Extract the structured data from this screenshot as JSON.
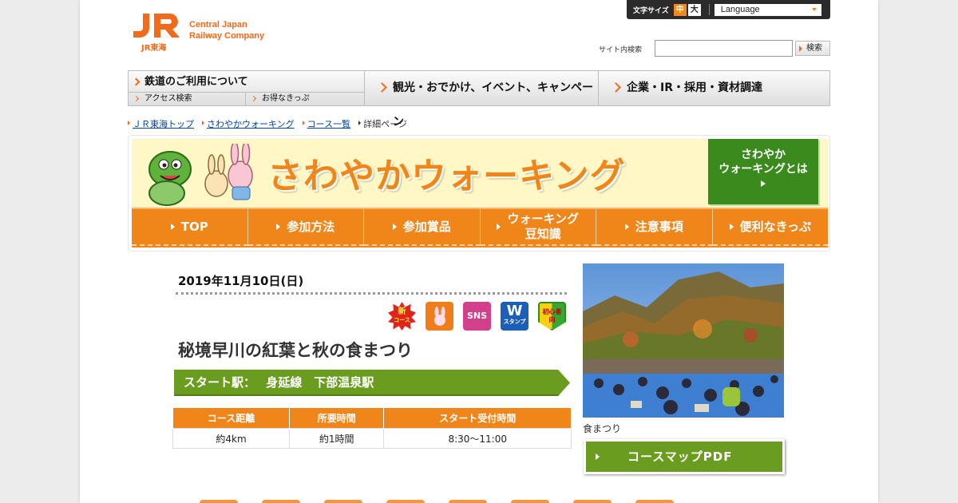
{
  "header": {
    "logo_mark": "JR",
    "logo_sub": "JR東海",
    "logo_text_line1": "Central Japan",
    "logo_text_line2": "Railway Company",
    "font_size_label": "文字サイズ",
    "font_size_mid": "中",
    "font_size_large": "大",
    "language_label": "Language",
    "search_label": "サイト内検索",
    "search_value": "",
    "search_button": "検索"
  },
  "gnav": {
    "rail": "鉄道のご利用について",
    "rail_sub1": "アクセス検索",
    "rail_sub2": "お得なきっぷ",
    "tour": "観光・おでかけ、イベント、キャンペーン",
    "corp": "企業・IR・採用・資材調達"
  },
  "breadcrumb": {
    "items": [
      "ＪＲ東海トップ",
      "さわやかウォーキング",
      "コース一覧"
    ],
    "current": "詳細ページ"
  },
  "banner": {
    "title": "さわやかウォーキング",
    "about_line1": "さわやか",
    "about_line2": "ウォーキングとは",
    "tabs": [
      {
        "label": "TOP"
      },
      {
        "label": "参加方法"
      },
      {
        "label": "参加賞品"
      },
      {
        "label": "ウォーキング豆知識",
        "line1": "ウォーキング",
        "line2": "豆知識"
      },
      {
        "label": "注意事項"
      },
      {
        "label": "便利なきっぷ"
      }
    ]
  },
  "event": {
    "date": "2019年11月10日(日)",
    "badges": {
      "new": "新",
      "new_sub": "コース",
      "sns": "SNS",
      "w": "W",
      "w_sub": "スタンプ",
      "beginner": "初心者向"
    },
    "title": "秘境早川の紅葉と秋の食まつり",
    "start_label": "スタート駅：",
    "start_station": "身延線　下部温泉駅",
    "table": {
      "headers": [
        "コース距離",
        "所要時間",
        "スタート受付時間"
      ],
      "values": [
        "約4km",
        "約1時間",
        "8:30～11:00"
      ]
    },
    "photo_caption": "食まつり",
    "pdf_button": "コースマップPDF"
  },
  "colors": {
    "brand_orange": "#f08519",
    "jr_orange": "#f26a1b",
    "green": "#6a9d1f",
    "banner_yellow": "#fff8c6"
  }
}
